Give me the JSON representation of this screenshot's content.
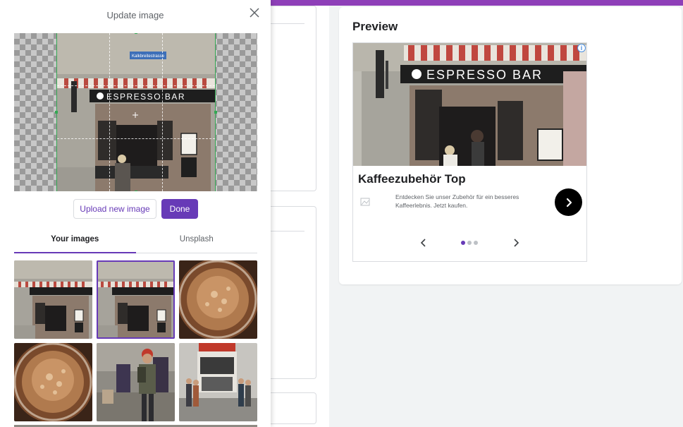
{
  "panel": {
    "title": "Update image",
    "close_icon": "close-icon",
    "buttons": {
      "upload_label": "Upload new image",
      "done_label": "Done"
    },
    "tabs": [
      {
        "label": "Your images",
        "active": true
      },
      {
        "label": "Unsplash",
        "active": false
      }
    ],
    "crop_sign_text": "Kalkbreitestrasse",
    "thumbnails": [
      {
        "name": "espresso-bar-storefront",
        "selected": false
      },
      {
        "name": "espresso-bar-storefront",
        "selected": true
      },
      {
        "name": "coffee-crema-cup",
        "selected": false
      },
      {
        "name": "coffee-crema-cup",
        "selected": false
      },
      {
        "name": "street-person-backpack",
        "selected": false
      },
      {
        "name": "food-kiosk-street",
        "selected": false
      }
    ]
  },
  "preview": {
    "title": "Preview",
    "ad": {
      "headline": "Kaffeezubehör Top",
      "description": "Entdecken Sie unser Zubehör für ein besseres Kaffeerlebnis. Jetzt kaufen.",
      "sign_text": "ESPRESSO BAR",
      "cta_icon": "chevron-right-icon",
      "carousel": {
        "total": 3,
        "active_index": 0
      }
    }
  },
  "colors": {
    "accent": "#673ab7",
    "top_bar": "#8e3fb8",
    "crop_frame": "#34a853"
  }
}
